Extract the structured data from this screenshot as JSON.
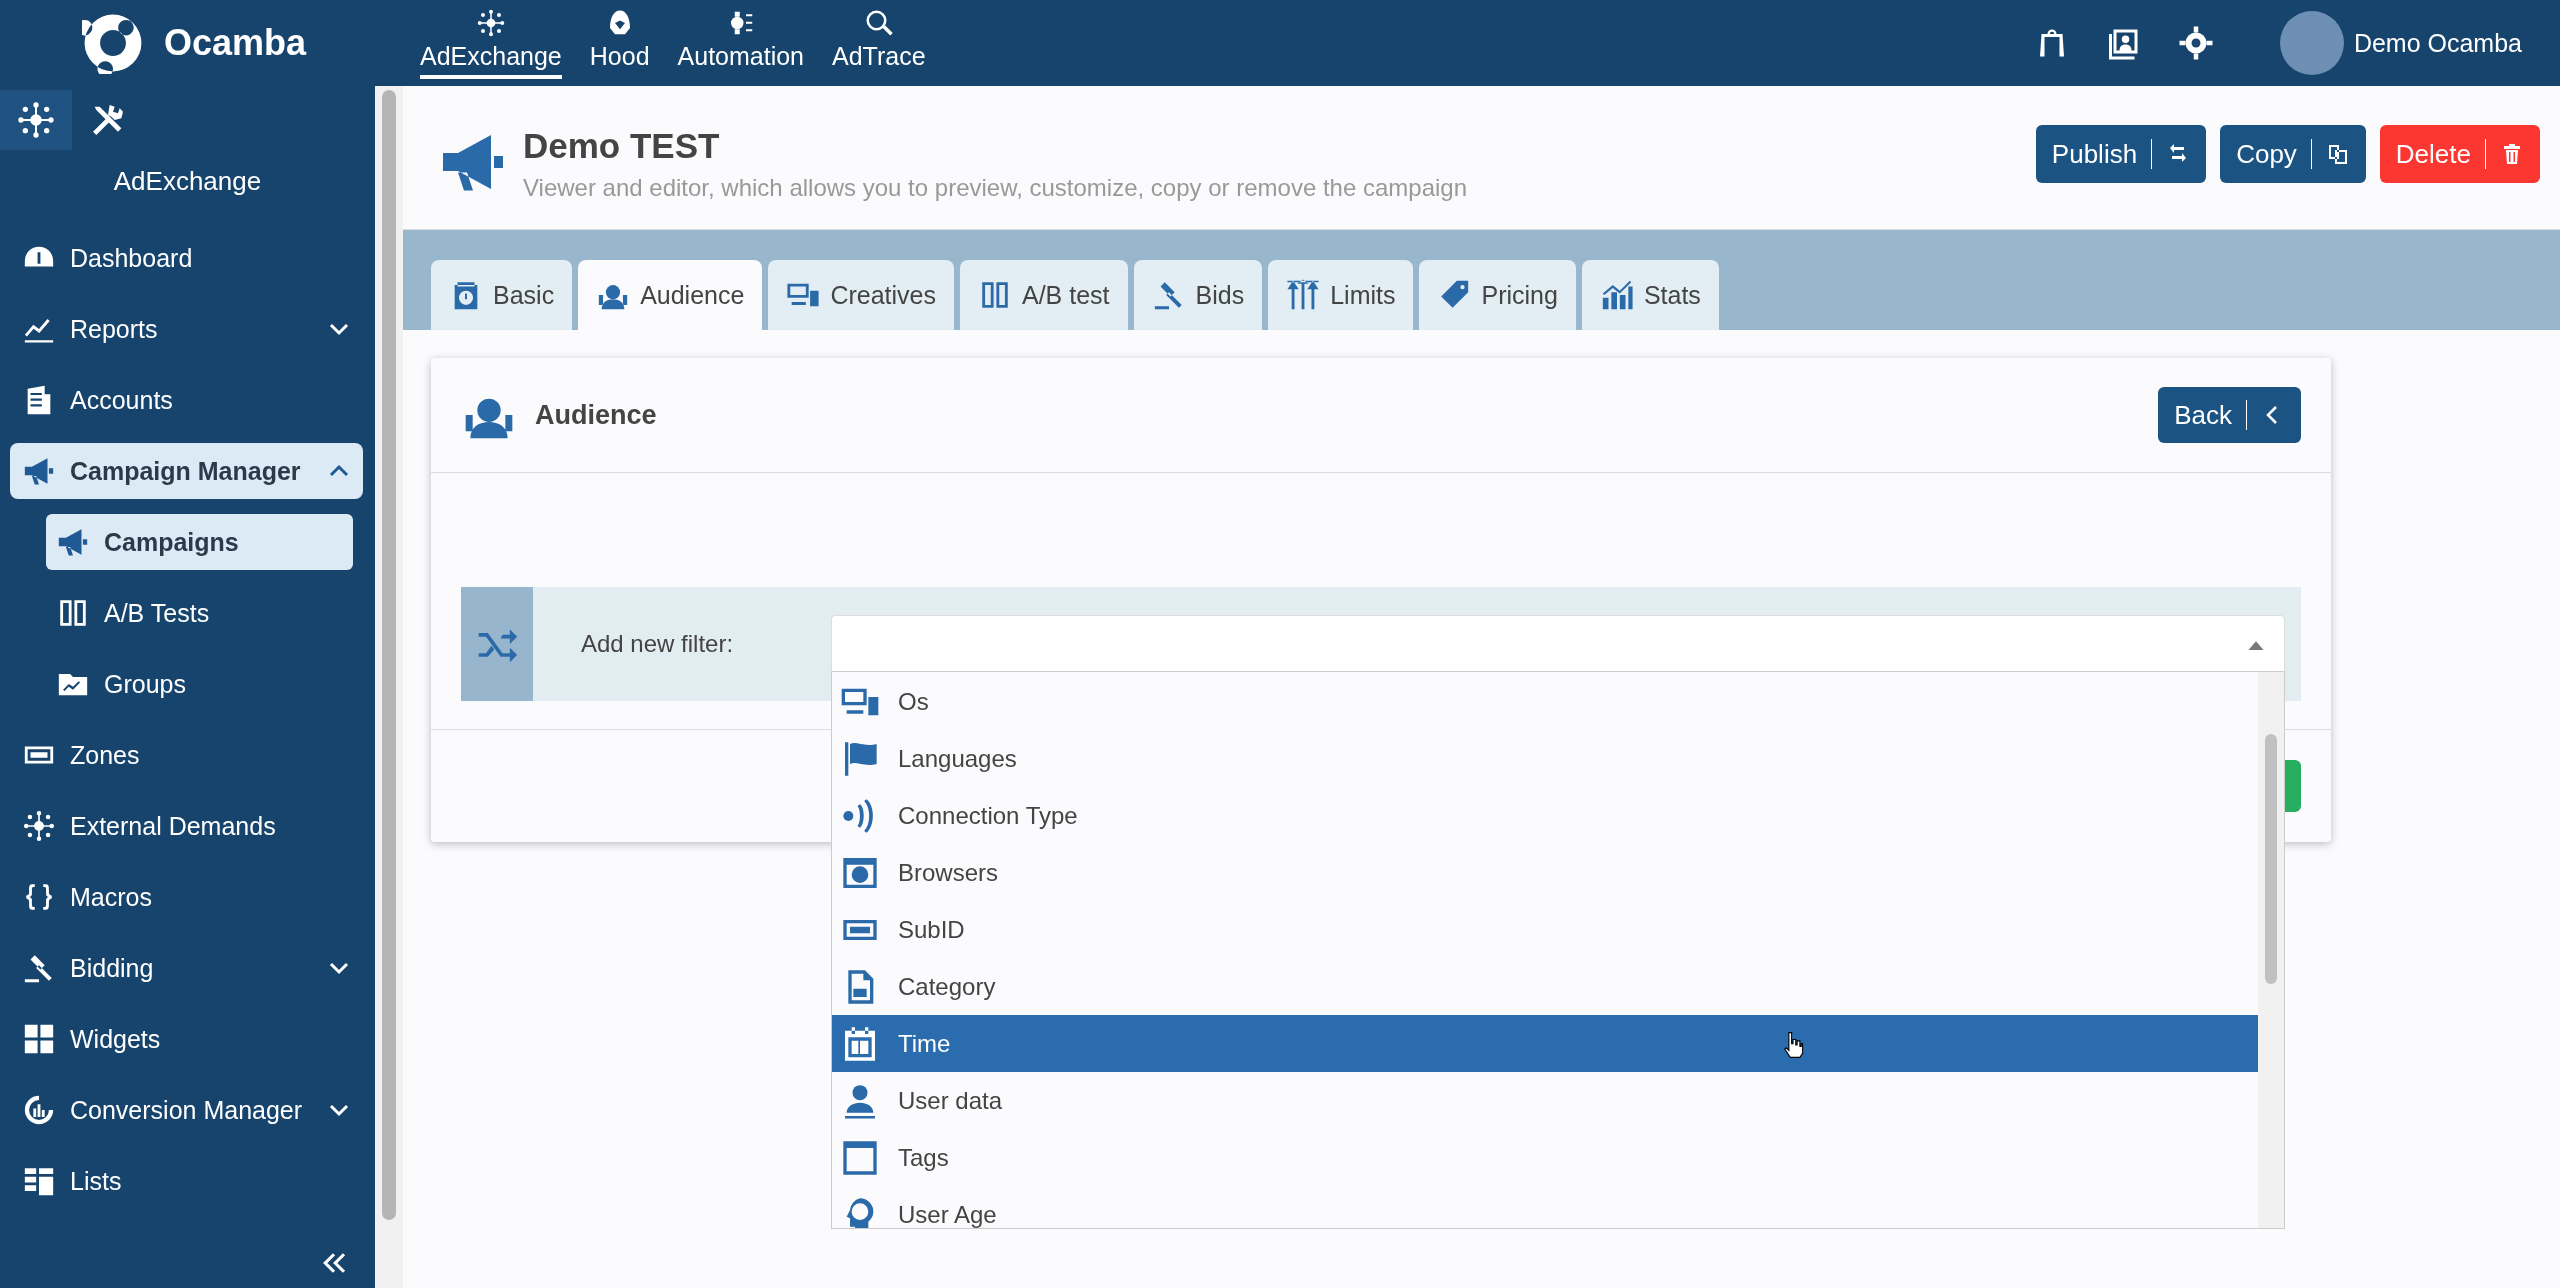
{
  "brand": {
    "name": "Ocamba"
  },
  "top_nav": [
    {
      "label": "AdExchange",
      "selected": true
    },
    {
      "label": "Hood",
      "selected": false
    },
    {
      "label": "Automation",
      "selected": false
    },
    {
      "label": "AdTrace",
      "selected": false
    }
  ],
  "user": {
    "name": "Demo Ocamba"
  },
  "sidebar": {
    "module_tabs": [
      {
        "selected": true
      },
      {
        "selected": false
      }
    ],
    "module_title": "AdExchange",
    "items": [
      {
        "label": "Dashboard",
        "kind": "link",
        "selected": false
      },
      {
        "label": "Reports",
        "kind": "group",
        "expanded": false,
        "selected": false
      },
      {
        "label": "Accounts",
        "kind": "link",
        "selected": false
      },
      {
        "label": "Campaign Manager",
        "kind": "group",
        "expanded": true,
        "selected": true,
        "children": [
          {
            "label": "Campaigns",
            "selected": true
          },
          {
            "label": "A/B Tests",
            "selected": false
          },
          {
            "label": "Groups",
            "selected": false
          }
        ]
      },
      {
        "label": "Zones",
        "kind": "link",
        "selected": false
      },
      {
        "label": "External Demands",
        "kind": "link",
        "selected": false
      },
      {
        "label": "Macros",
        "kind": "link",
        "selected": false
      },
      {
        "label": "Bidding",
        "kind": "group",
        "expanded": false,
        "selected": false
      },
      {
        "label": "Widgets",
        "kind": "link",
        "selected": false
      },
      {
        "label": "Conversion Manager",
        "kind": "group",
        "expanded": false,
        "selected": false
      },
      {
        "label": "Lists",
        "kind": "link",
        "selected": false
      }
    ]
  },
  "page": {
    "title": "Demo TEST",
    "subtitle": "Viewer and editor, which allows you to preview, customize, copy or remove the campaign",
    "actions": [
      {
        "label": "Publish",
        "kind": "primary"
      },
      {
        "label": "Copy",
        "kind": "primary"
      },
      {
        "label": "Delete",
        "kind": "danger"
      }
    ]
  },
  "tabs": [
    {
      "label": "Basic",
      "selected": false
    },
    {
      "label": "Audience",
      "selected": true
    },
    {
      "label": "Creatives",
      "selected": false
    },
    {
      "label": "A/B test",
      "selected": false
    },
    {
      "label": "Bids",
      "selected": false
    },
    {
      "label": "Limits",
      "selected": false
    },
    {
      "label": "Pricing",
      "selected": false
    },
    {
      "label": "Stats",
      "selected": false
    }
  ],
  "panel": {
    "title": "Audience",
    "back_button": "Back",
    "filter": {
      "label": "Add new filter:",
      "expanded": true,
      "options": [
        {
          "label": "Os",
          "selected": false
        },
        {
          "label": "Languages",
          "selected": false
        },
        {
          "label": "Connection Type",
          "selected": false
        },
        {
          "label": "Browsers",
          "selected": false
        },
        {
          "label": "SubID",
          "selected": false
        },
        {
          "label": "Category",
          "selected": false
        },
        {
          "label": "Time",
          "selected": true
        },
        {
          "label": "User data",
          "selected": false
        },
        {
          "label": "Tags",
          "selected": false
        },
        {
          "label": "User Age",
          "selected": false
        }
      ]
    }
  }
}
